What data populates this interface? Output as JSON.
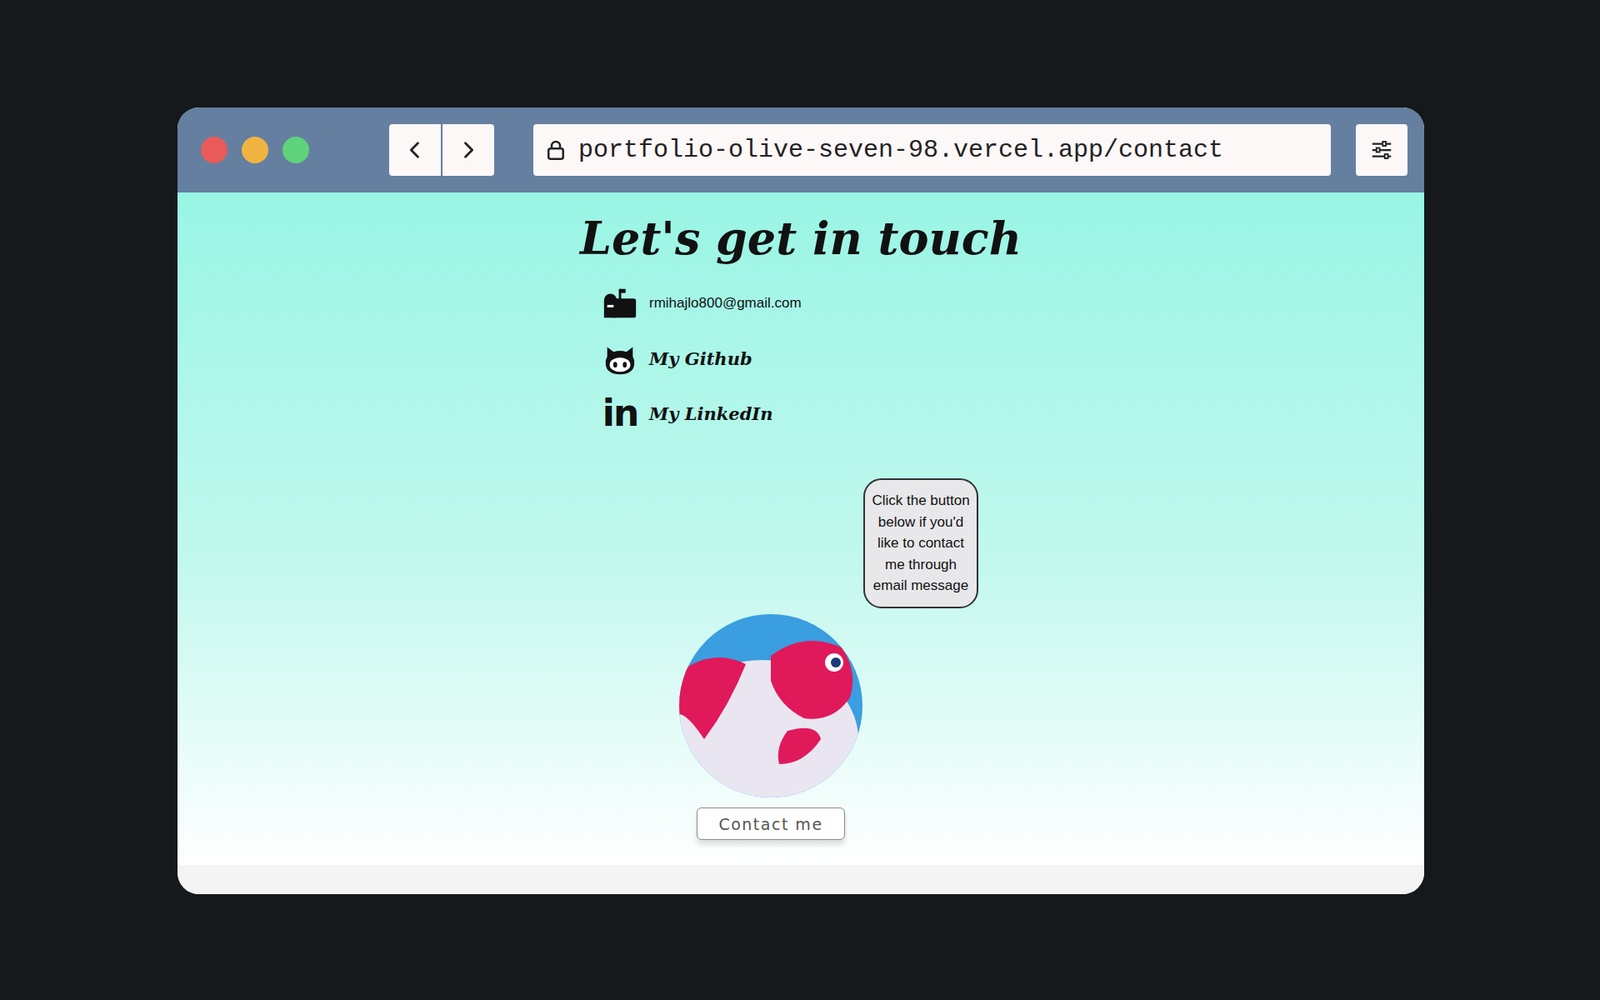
{
  "browser": {
    "url": "portfolio-olive-seven-98.vercel.app/contact"
  },
  "page": {
    "title": "Let's get in touch"
  },
  "contacts": [
    {
      "kind": "email",
      "label": "rmihajlo800@gmail.com",
      "icon_text": ""
    },
    {
      "kind": "github",
      "label": "My Github",
      "icon_text": ""
    },
    {
      "kind": "linkedin",
      "label": "My LinkedIn",
      "icon_text": "in"
    }
  ],
  "bubble": {
    "text": "Click the button below if you'd like to contact me through email message"
  },
  "button": {
    "label": "Contact me"
  }
}
